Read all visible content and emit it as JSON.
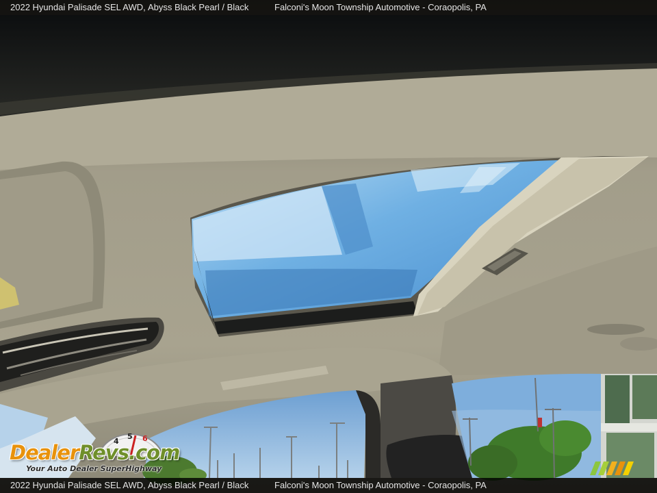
{
  "caption": {
    "vehicle": "2022 Hyundai Palisade SEL AWD,",
    "color": "Abyss Black Pearl / Black",
    "dealer": "Falconi's Moon Township Automotive - Coraopolis, PA"
  },
  "watermark": {
    "brand_dealer": "Dealer",
    "brand_revs": "Revs",
    "brand_com": ".com",
    "tagline": "Your Auto Dealer SuperHighway",
    "gauge_numbers": [
      "4",
      "5",
      "6"
    ]
  },
  "colors": {
    "brand_orange": "#e8920c",
    "brand_green": "#6f8f2a",
    "sky": "#7fb2dc",
    "headliner": "#9a9583"
  }
}
